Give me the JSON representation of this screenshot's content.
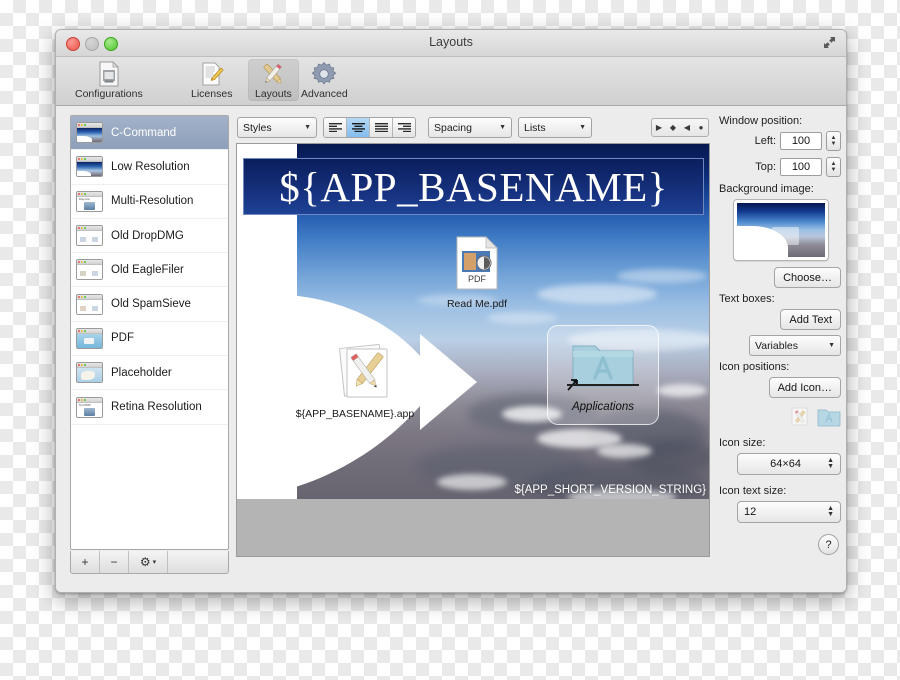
{
  "window": {
    "title": "Layouts",
    "traffic_lights": [
      "close",
      "minimize",
      "zoom"
    ],
    "fullscreen_icon": "fullscreen-expand-icon"
  },
  "toolbar": {
    "items": [
      {
        "label": "Configurations",
        "icon": "document-gear-icon",
        "selected": false
      },
      {
        "label": "Licenses",
        "icon": "document-pencil-icon",
        "selected": false
      },
      {
        "label": "Layouts",
        "icon": "pencil-ruler-icon",
        "selected": true
      },
      {
        "label": "Advanced",
        "icon": "gear-icon",
        "selected": false
      }
    ]
  },
  "sidebar": {
    "items": [
      {
        "label": "C-Command",
        "selected": true
      },
      {
        "label": "Low Resolution",
        "selected": false
      },
      {
        "label": "Multi-Resolution",
        "selected": false
      },
      {
        "label": "Old DropDMG",
        "selected": false
      },
      {
        "label": "Old EagleFiler",
        "selected": false
      },
      {
        "label": "Old SpamSieve",
        "selected": false
      },
      {
        "label": "PDF",
        "selected": false
      },
      {
        "label": "Placeholder",
        "selected": false
      },
      {
        "label": "Retina Resolution",
        "selected": false
      }
    ],
    "footer": {
      "add_label": "+",
      "remove_label": "−",
      "action_label": "⚙",
      "action_arrow": "▾"
    }
  },
  "editor_toolbar": {
    "styles_label": "Styles",
    "spacing_label": "Spacing",
    "lists_label": "Lists",
    "dropdown_arrow": "▼",
    "alignment": [
      {
        "name": "align-left",
        "selected": false
      },
      {
        "name": "align-center",
        "selected": true
      },
      {
        "name": "align-justify",
        "selected": false
      },
      {
        "name": "align-right",
        "selected": false
      }
    ],
    "markers": [
      {
        "name": "triangle-right-marker",
        "glyph": "▶"
      },
      {
        "name": "diamond-marker",
        "glyph": "◆"
      },
      {
        "name": "triangle-left-marker",
        "glyph": "◀"
      },
      {
        "name": "circle-marker",
        "glyph": "●"
      }
    ]
  },
  "canvas": {
    "title_text": "${APP_BASENAME}",
    "version_text": "${APP_SHORT_VERSION_STRING}",
    "icons": [
      {
        "name": "readme-pdf",
        "caption": "Read Me.pdf",
        "badge": "PDF"
      },
      {
        "name": "app-bundle",
        "caption": "${APP_BASENAME}.app"
      },
      {
        "name": "applications-folder",
        "caption": "Applications",
        "selected": true
      }
    ]
  },
  "inspector": {
    "window_position_label": "Window position:",
    "left_label": "Left:",
    "left_value": "100",
    "top_label": "Top:",
    "top_value": "100",
    "background_image_label": "Background image:",
    "choose_label": "Choose…",
    "text_boxes_label": "Text boxes:",
    "add_text_label": "Add Text",
    "variables_label": "Variables",
    "variables_arrow": "▼",
    "icon_positions_label": "Icon positions:",
    "add_icon_label": "Add Icon…",
    "position_icons": [
      "app-bundle-icon",
      "applications-folder-icon"
    ],
    "icon_size_label": "Icon size:",
    "icon_size_value": "64×64",
    "icon_text_size_label": "Icon text size:",
    "icon_text_size_value": "12",
    "help_label": "?"
  }
}
